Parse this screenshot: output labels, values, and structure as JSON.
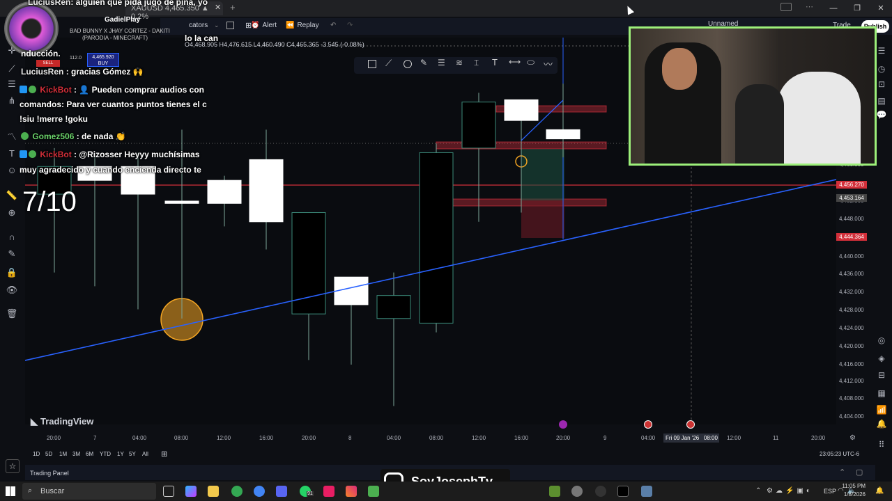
{
  "browser": {
    "tab_title": "XAUUSD 4,465.350 ▲ 0.2%",
    "close_tab": "✕",
    "new_tab": "+"
  },
  "toolbar": {
    "indicators": "cators",
    "alert": "Alert",
    "replay": "Replay",
    "layout_name": "Unnamed",
    "publish": "Publish",
    "trade": "Trade"
  },
  "ohlc": {
    "text": "O4,468.905  H4,476.615  L4,460.490  C4,465.365  -3.545 (-0.08%)"
  },
  "order": {
    "sell_label": "SELL",
    "buy_price": "4,465.920",
    "buy_label": "BUY",
    "spread": "112.0"
  },
  "now_playing": {
    "user": "GadielPlay",
    "song_line1": "BAD BUNNY X JHAY CORTEZ - DAKITI",
    "song_line2": "(PARODIA - MINECRAFT)"
  },
  "chat": {
    "line0": {
      "user": "LuciusRen",
      "text": ": alguien que pida jugo de piña, yo"
    },
    "line0b": {
      "text": "nducción."
    },
    "line1": {
      "user": "LuciusRen",
      "text": ": gracias Gómez 🙌"
    },
    "line2": {
      "user": "KickBot",
      "text": ": 👤 Pueden comprar audios con"
    },
    "line3": {
      "text": "comandos: Para ver cuantos puntos tienes el c"
    },
    "line4": {
      "text": "!siu !merre !goku"
    },
    "line5": {
      "user": "Gomez506",
      "text": ": de nada 👏"
    },
    "line6": {
      "user": "KickBot",
      "text": ": @Rizosser Heyyy muchísimas"
    },
    "line7": {
      "text": "muy agradecido y cuando encienda directo te"
    },
    "rating": "7/10",
    "partial": "lo la can"
  },
  "price_axis": {
    "labels": [
      "4,460.000",
      "4,452.000",
      "4,448.000",
      "4,444.000",
      "4,440.000",
      "4,436.000",
      "4,432.000",
      "4,428.000",
      "4,424.000",
      "4,420.000",
      "4,416.000",
      "4,412.000",
      "4,408.000",
      "4,404.000"
    ],
    "badge_red": "4,456.270",
    "badge_gray": "4,453.164",
    "badge_red2": "4,444.364"
  },
  "time_axis": {
    "labels": [
      "20:00",
      "7",
      "04:00",
      "08:00",
      "12:00",
      "16:00",
      "20:00",
      "8",
      "04:00",
      "08:00",
      "12:00",
      "16:00",
      "20:00",
      "9",
      "04:00",
      "12:00",
      "11",
      "20:00"
    ],
    "cursor_label": "Fri 09 Jan '26",
    "cursor_time": "08:00"
  },
  "periods": [
    "1D",
    "5D",
    "1M",
    "3M",
    "6M",
    "YTD",
    "1Y",
    "5Y",
    "All"
  ],
  "clock": "23:05:23 UTC-6",
  "brand": "TradingView",
  "trading_panel": "Trading Panel",
  "streamer": "SoyJosephTv",
  "taskbar": {
    "search_placeholder": "Buscar",
    "lang": "ESP",
    "time": "11:05 PM",
    "date": "1/8/2026",
    "badge_count": "91"
  },
  "chart_data": {
    "type": "candlestick",
    "candles": [
      {
        "o": 4458,
        "h": 4462,
        "l": 4435,
        "c": 4452
      },
      {
        "o": 4455,
        "h": 4461,
        "l": 4432,
        "c": 4458
      },
      {
        "o": 4452,
        "h": 4461,
        "l": 4427,
        "c": 4458
      },
      {
        "o": 4450,
        "h": 4466,
        "l": 4425,
        "c": 4450.5
      },
      {
        "o": 4450,
        "h": 4456,
        "l": 4445,
        "c": 4455
      },
      {
        "o": 4446,
        "h": 4466,
        "l": 4440,
        "c": 4459.5
      },
      {
        "o": 4448,
        "h": 4448,
        "l": 4416,
        "c": 4426
      },
      {
        "o": 4428,
        "h": 4431,
        "l": 4415,
        "c": 4434
      },
      {
        "o": 4430,
        "h": 4435,
        "l": 4406,
        "c": 4425
      },
      {
        "o": 4461,
        "h": 4463,
        "l": 4422,
        "c": 4424
      },
      {
        "o": 4472,
        "h": 4474,
        "l": 4446,
        "c": 4462
      },
      {
        "o": 4468,
        "h": 4472,
        "l": 4448,
        "c": 4472.5
      },
      {
        "o": 4464,
        "h": 4476,
        "l": 4460,
        "c": 4466
      }
    ],
    "ylim": [
      4402,
      4486
    ]
  }
}
